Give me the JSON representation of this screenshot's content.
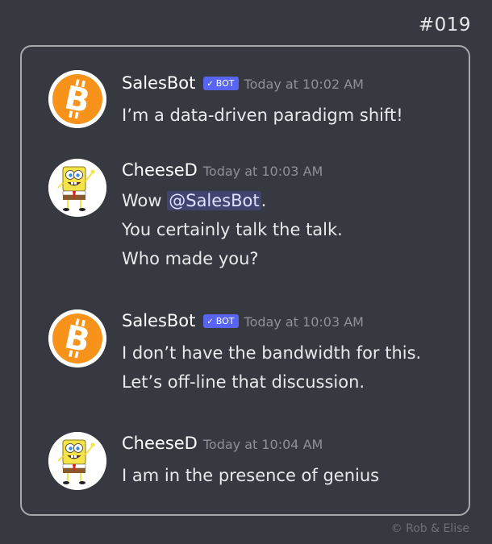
{
  "episode_number": "#019",
  "copyright": "©  Rob & Elise",
  "bot_tag_label": "BOT",
  "messages": [
    {
      "username": "SalesBot",
      "is_bot": true,
      "avatar_icon": "bitcoin-icon",
      "timestamp": "Today at 10:02 AM",
      "lines": [
        "I’m a data-driven paradigm shift!"
      ]
    },
    {
      "username": "CheeseD",
      "is_bot": false,
      "avatar_icon": "spongebob-icon",
      "timestamp": "Today at 10:03 AM",
      "line1_prefix": "Wow ",
      "line1_mention": "@SalesBot",
      "line1_suffix": ".",
      "lines": [
        "You certainly talk the talk.",
        "Who made you?"
      ]
    },
    {
      "username": "SalesBot",
      "is_bot": true,
      "avatar_icon": "bitcoin-icon",
      "timestamp": "Today at 10:03 AM",
      "lines": [
        "I don’t have the bandwidth for this.",
        "Let’s off-line that discussion."
      ]
    },
    {
      "username": "CheeseD",
      "is_bot": false,
      "avatar_icon": "spongebob-icon",
      "timestamp": "Today at 10:04 AM",
      "lines": [
        "I am in the presence of genius"
      ]
    }
  ],
  "colors": {
    "background": "#36393f",
    "bot_tag": "#5865f2",
    "mention_bg": "#41446e",
    "bitcoin_orange": "#f7931a"
  }
}
